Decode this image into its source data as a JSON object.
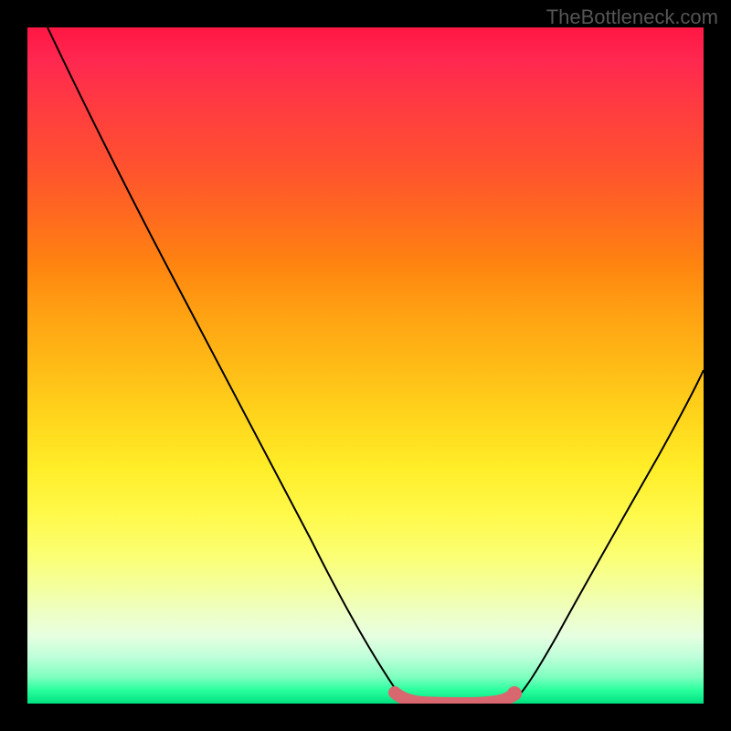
{
  "watermark": "TheBottleneck.com",
  "chart_data": {
    "type": "line",
    "title": "",
    "xlabel": "",
    "ylabel": "",
    "xlim": [
      0,
      100
    ],
    "ylim": [
      0,
      100
    ],
    "series": [
      {
        "name": "left-curve",
        "x": [
          3,
          8,
          14,
          20,
          26,
          32,
          38,
          44,
          49,
          52,
          54,
          56
        ],
        "values": [
          100,
          90,
          79,
          68,
          57,
          46,
          35,
          24,
          13,
          6,
          2,
          0
        ]
      },
      {
        "name": "right-curve",
        "x": [
          72,
          74,
          77,
          81,
          85,
          89,
          93,
          97,
          100
        ],
        "values": [
          0,
          2,
          7,
          15,
          24,
          34,
          43,
          51,
          57
        ]
      },
      {
        "name": "valley-floor",
        "x": [
          54,
          56,
          58,
          60,
          62,
          64,
          66,
          68,
          70,
          72
        ],
        "values": [
          1.2,
          0.4,
          0.1,
          0,
          0,
          0,
          0,
          0.1,
          0.5,
          1.3
        ]
      }
    ],
    "annotations": [
      {
        "name": "valley-end-dot",
        "x": 72,
        "y": 1.5
      }
    ],
    "colors": {
      "gradient_top": "#ff1744",
      "gradient_mid": "#ffd61c",
      "gradient_bottom": "#00e080",
      "curve": "#000000",
      "valley_highlight": "#d9676f",
      "background": "#000000"
    }
  }
}
